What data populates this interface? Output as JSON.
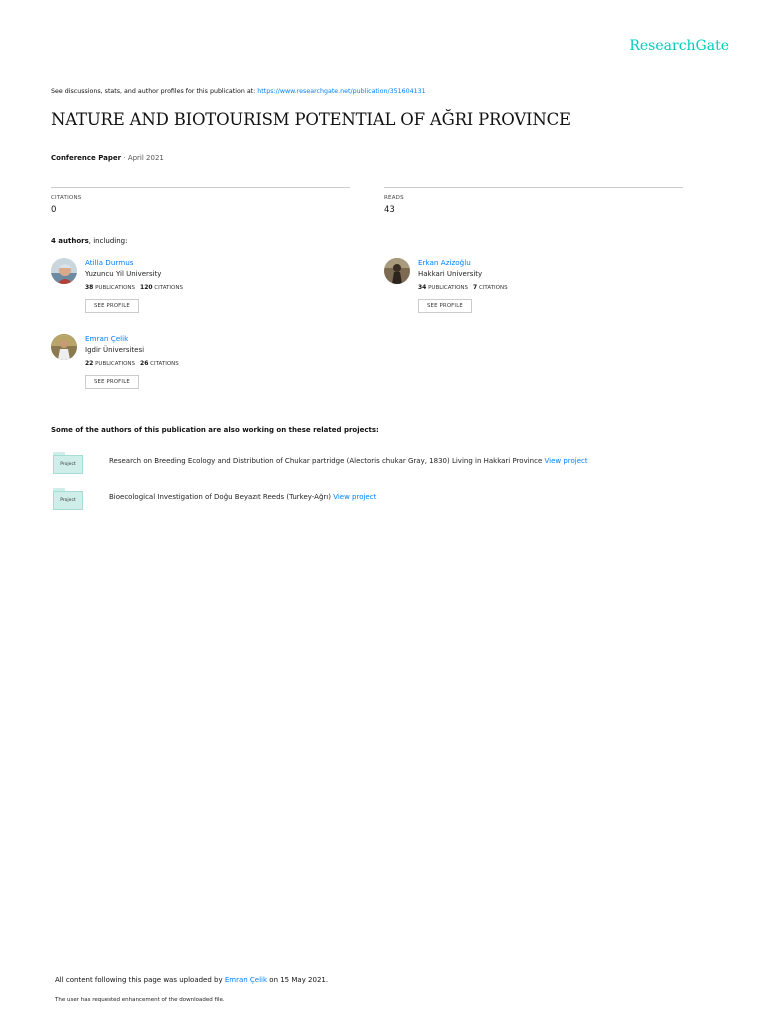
{
  "header": {
    "logo": "ResearchGate",
    "discuss_prefix": "See discussions, stats, and author profiles for this publication at: ",
    "discuss_url": "https://www.researchgate.net/publication/351604131"
  },
  "paper": {
    "title": "NATURE AND BIOTOURISM POTENTIAL OF AĞRI PROVINCE",
    "type": "Conference Paper",
    "date_sep": " · ",
    "date": "April 2021"
  },
  "stats": {
    "citations_label": "CITATIONS",
    "citations_value": "0",
    "reads_label": "READS",
    "reads_value": "43"
  },
  "authors_section": {
    "count": "4 authors",
    "suffix": ", including:"
  },
  "authors": [
    {
      "name": "Atilla Durmus",
      "institution": "Yuzuncu Yil University",
      "publications": "38",
      "publications_label": "PUBLICATIONS",
      "citations": "120",
      "citations_label": "CITATIONS",
      "button": "SEE PROFILE"
    },
    {
      "name": "Erkan Azizoğlu",
      "institution": "Hakkari University",
      "publications": "34",
      "publications_label": "PUBLICATIONS",
      "citations": "7",
      "citations_label": "CITATIONS",
      "button": "SEE PROFILE"
    },
    {
      "name": "Emran Çelik",
      "institution": "Igdir Üniversitesi",
      "publications": "22",
      "publications_label": "PUBLICATIONS",
      "citations": "26",
      "citations_label": "CITATIONS",
      "button": "SEE PROFILE"
    }
  ],
  "related": {
    "heading": "Some of the authors of this publication are also working on these related projects:",
    "projects": [
      {
        "icon_label": "Project",
        "text": "Research on Breeding Ecology and Distribution of Chukar partridge (Alectoris chukar Gray, 1830) Living in Hakkari Province",
        "link": "View project"
      },
      {
        "icon_label": "Project",
        "text": "Bioecological Investigation of Doğu Beyazıt Reeds (Turkey-Ağrı)",
        "link": "View project"
      }
    ]
  },
  "footer": {
    "prefix": "All content following this page was uploaded by ",
    "uploader": "Emran Çelik",
    "suffix": " on 15 May 2021.",
    "note": "The user has requested enhancement of the downloaded file."
  },
  "colors": {
    "brand": "#00ccbb",
    "link": "#0080ff",
    "project_icon": "#cfeee9"
  }
}
